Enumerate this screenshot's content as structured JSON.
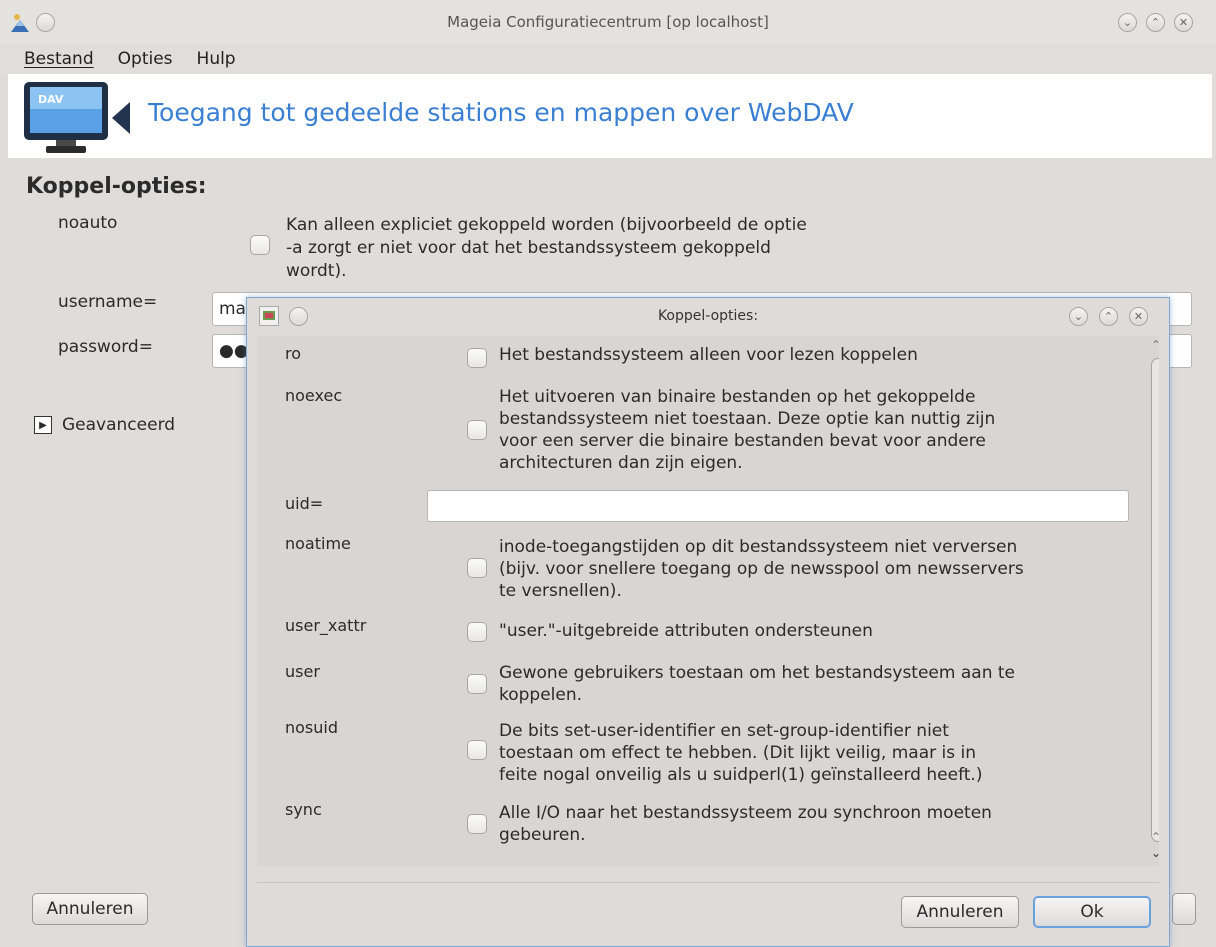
{
  "window": {
    "title": "Mageia Configuratiecentrum  [op localhost]"
  },
  "menu": {
    "file": "Bestand",
    "options": "Opties",
    "help": "Hulp"
  },
  "banner": {
    "icon_text": "DAV",
    "title": "Toegang tot gedeelde stations en mappen over WebDAV"
  },
  "main": {
    "section_title": "Koppel-opties:",
    "noauto_label": "noauto",
    "noauto_desc_1": "Kan alleen expliciet gekoppeld worden (bijvoorbeeld de optie",
    "noauto_desc_2": "-a zorgt er niet voor dat het bestandssysteem gekoppeld",
    "noauto_desc_3": "wordt).",
    "username_label": "username=",
    "username_value": "ma",
    "password_label": "password=",
    "password_value": "●●",
    "advanced_label": "Geavanceerd",
    "cancel_button": "Annuleren"
  },
  "dialog": {
    "title": "Koppel-opties:",
    "cancel_button": "Annuleren",
    "ok_button": "Ok",
    "options": [
      {
        "label": "ro",
        "lines": [
          "Het bestandssysteem alleen voor lezen koppelen"
        ]
      },
      {
        "label": "noexec",
        "lines": [
          "Het uitvoeren van binaire bestanden op het gekoppelde",
          "bestandssysteem niet toestaan. Deze optie kan nuttig zijn",
          "voor een server die binaire bestanden bevat voor andere",
          "architecturen dan zijn eigen."
        ]
      },
      {
        "label": "uid=",
        "lines": []
      },
      {
        "label": "noatime",
        "lines": [
          "inode-toegangstijden op dit bestandssysteem niet verversen",
          "(bijv. voor snellere toegang op de newsspool om newsservers",
          "te versnellen)."
        ]
      },
      {
        "label": "user_xattr",
        "lines": [
          "\"user.\"-uitgebreide attributen ondersteunen"
        ]
      },
      {
        "label": "user",
        "lines": [
          "Gewone gebruikers toestaan om het bestandsysteem aan te",
          "koppelen."
        ]
      },
      {
        "label": "nosuid",
        "lines": [
          "De bits set-user-identifier en set-group-identifier niet",
          "toestaan om effect te hebben. (Dit lijkt veilig, maar is in",
          "feite nogal onveilig als u suidperl(1) geïnstalleerd heeft.)"
        ]
      },
      {
        "label": "sync",
        "lines": [
          "Alle I/O naar het bestandssysteem zou synchroon moeten",
          "gebeuren."
        ]
      }
    ]
  }
}
